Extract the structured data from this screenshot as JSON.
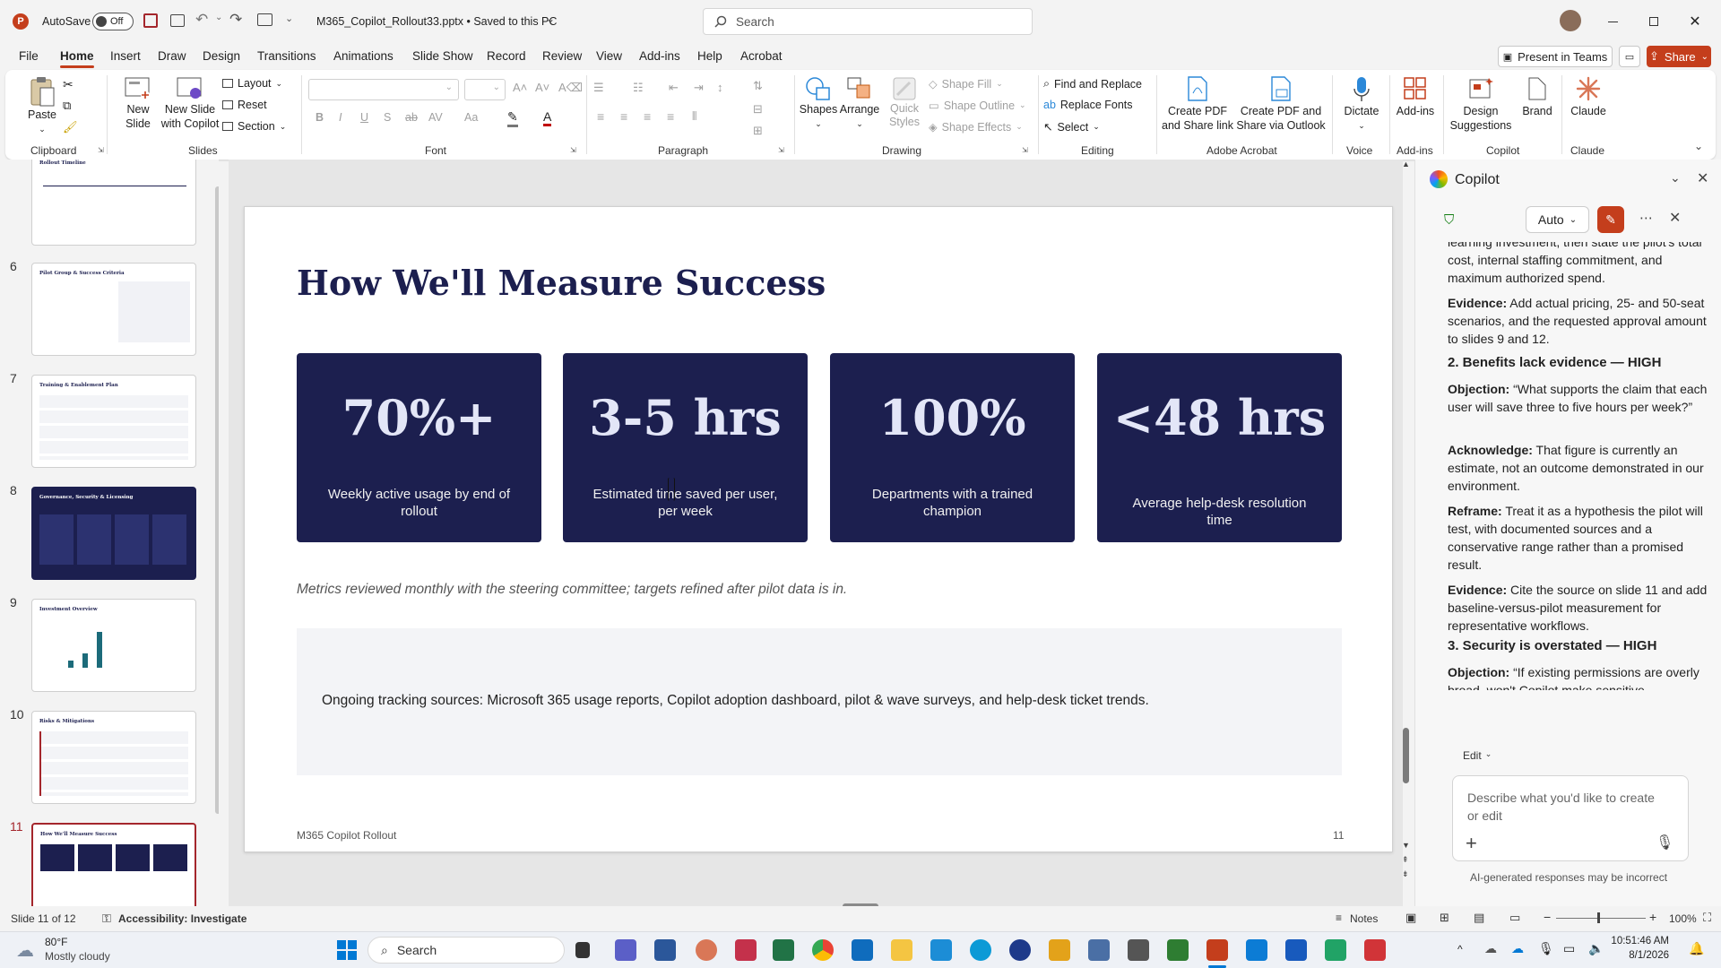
{
  "titlebar": {
    "autosave_label": "AutoSave",
    "autosave_state": "Off",
    "filename": "M365_Copilot_Rollout33.pptx • Saved to this PC",
    "search_placeholder": "Search"
  },
  "menu": {
    "items": [
      "File",
      "Home",
      "Insert",
      "Draw",
      "Design",
      "Transitions",
      "Animations",
      "Slide Show",
      "Record",
      "Review",
      "View",
      "Add-ins",
      "Help",
      "Acrobat"
    ],
    "active": "Home",
    "present_in_teams": "Present in Teams",
    "share": "Share"
  },
  "ribbon": {
    "clipboard": {
      "paste": "Paste",
      "label": "Clipboard"
    },
    "slides": {
      "new_slide": "New Slide",
      "new_slide_copilot": "New Slide with Copilot",
      "layout": "Layout",
      "reset": "Reset",
      "section": "Section",
      "label": "Slides"
    },
    "font": {
      "label": "Font"
    },
    "paragraph": {
      "label": "Paragraph"
    },
    "drawing": {
      "shapes": "Shapes",
      "arrange": "Arrange",
      "quick_styles": "Quick Styles",
      "shape_fill": "Shape Fill",
      "shape_outline": "Shape Outline",
      "shape_effects": "Shape Effects",
      "label": "Drawing"
    },
    "editing": {
      "find_replace": "Find and Replace",
      "replace_fonts": "Replace Fonts",
      "select": "Select",
      "label": "Editing"
    },
    "acrobat": {
      "create_pdf_share": "Create PDF and Share link",
      "create_pdf_outlook": "Create PDF and Share via Outlook",
      "label": "Adobe Acrobat"
    },
    "voice": {
      "dictate": "Dictate",
      "label": "Voice"
    },
    "addins": {
      "addins": "Add-ins",
      "label": "Add-ins"
    },
    "copilot": {
      "design_suggestions": "Design Suggestions",
      "brand": "Brand",
      "label": "Copilot"
    },
    "claude": {
      "claude": "Claude",
      "label": "Claude"
    }
  },
  "thumbnails": [
    {
      "num": "",
      "title": "Rollout Timeline"
    },
    {
      "num": "6",
      "title": "Pilot Group & Success Criteria"
    },
    {
      "num": "7",
      "title": "Training & Enablement Plan"
    },
    {
      "num": "8",
      "title": "Governance, Security & Licensing"
    },
    {
      "num": "9",
      "title": "Investment Overview"
    },
    {
      "num": "10",
      "title": "Risks & Mitigations"
    },
    {
      "num": "11",
      "title": "How We'll Measure Success"
    }
  ],
  "slide": {
    "title": "How We'll Measure Success",
    "cards": [
      {
        "value": "70%+",
        "label": "Weekly active usage by end of rollout"
      },
      {
        "value": "3-5 hrs",
        "label": "Estimated time saved per user, per week"
      },
      {
        "value": "100%",
        "label": "Departments with a trained champion"
      },
      {
        "value": "<48 hrs",
        "label": "Average help-desk resolution time"
      }
    ],
    "note": "Metrics reviewed monthly with the steering committee; targets refined after pilot data is in.",
    "sources": "Ongoing tracking sources: Microsoft 365 usage reports, Copilot adoption dashboard, pilot & wave surveys, and help-desk ticket trends.",
    "footer_left": "M365 Copilot Rollout",
    "footer_right": "11"
  },
  "copilot": {
    "title": "Copilot",
    "mode": "Auto",
    "text_top_1": "learning investment, then state the pilot's",
    "text_top_2": "total cost, internal staffing commitment, and maximum authorized spend.",
    "evidence_1_label": "Evidence:",
    "evidence_1": " Add actual pricing, 25- and 50-seat scenarios, and the requested approval amount to slides 9 and 12.",
    "heading_2": "2. Benefits lack evidence — HIGH",
    "objection_2_label": "Objection:",
    "objection_2": " “What supports the claim that each user will save three to five hours per week?”",
    "acknowledge_label": "Acknowledge:",
    "acknowledge": " That figure is currently an estimate, not an outcome demonstrated in our environment.",
    "reframe_label": "Reframe:",
    "reframe": " Treat it as a hypothesis the pilot will test, with documented sources and a conservative range rather than a promised result.",
    "evidence_2_label": "Evidence:",
    "evidence_2": " Cite the source on slide 11 and add baseline-versus-pilot measurement for representative workflows.",
    "heading_3": "3. Security is overstated — HIGH",
    "objection_3_label": "Objection:",
    "objection_3": " “If existing permissions are overly broad, won't Copilot make sensitive information easier to discover?”",
    "edit": "Edit",
    "input_placeholder": "Describe what you'd like to create or edit",
    "disclaimer": "AI-generated responses may be incorrect"
  },
  "statusbar": {
    "slide_info": "Slide 11 of 12",
    "accessibility": "Accessibility: Investigate",
    "notes": "Notes",
    "zoom": "100%"
  },
  "taskbar": {
    "temp": "80°F",
    "weather": "Mostly cloudy",
    "search": "Search",
    "time": "10:51:46 AM",
    "date": "8/1/2026"
  },
  "colors": {
    "navy": "#1c1f4f",
    "accent": "#c43e1c",
    "selected": "#a4262c"
  }
}
